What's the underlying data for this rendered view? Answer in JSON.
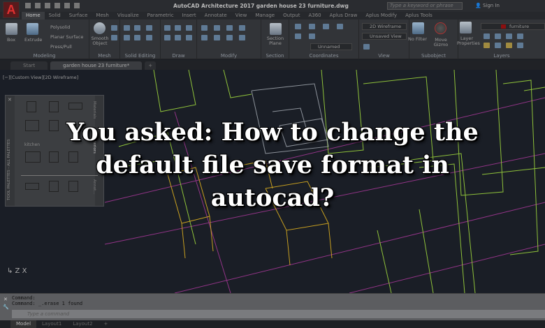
{
  "app": {
    "title": "AutoCAD Architecture 2017   garden house 23 furniture.dwg",
    "logo": "A"
  },
  "search": {
    "placeholder": "Type a keyword or phrase"
  },
  "account": {
    "sign_in": "Sign In"
  },
  "menu_tabs": [
    "Home",
    "Solid",
    "Surface",
    "Mesh",
    "Visualize",
    "Parametric",
    "Insert",
    "Annotate",
    "View",
    "Manage",
    "Output",
    "A360",
    "Aplus Draw",
    "Aplus Modify",
    "Aplus Tools"
  ],
  "ribbon": {
    "modeling": {
      "title": "Modeling",
      "box": "Box",
      "extrude": "Extrude",
      "polysolid": "Polysolid",
      "planar_surface": "Planar Surface",
      "presspull": "Press/Pull"
    },
    "mesh": {
      "title": "Mesh",
      "smooth_object": "Smooth Object"
    },
    "solid_editing": {
      "title": "Solid Editing"
    },
    "draw": {
      "title": "Draw"
    },
    "modify": {
      "title": "Modify"
    },
    "section": {
      "title": "Section",
      "section_plane": "Section Plane"
    },
    "coordinates": {
      "title": "Coordinates",
      "ucs": "Unnamed"
    },
    "view": {
      "title": "View",
      "visual_style": "2D Wireframe",
      "named_view": "Unsaved View"
    },
    "subobject": {
      "title": "Subobject",
      "no_filter": "No Filter",
      "move_gizmo": "Move Gizmo"
    },
    "layers": {
      "title": "Layers",
      "layer_properties": "Layer Properties",
      "current_layer": "furniture",
      "layer_color": "#8b1010"
    }
  },
  "doc_tabs": [
    {
      "label": "Start"
    },
    {
      "label": "garden house 23 furniture*"
    }
  ],
  "viewport": {
    "label": "[−][Custom View][2D Wireframe]"
  },
  "palette": {
    "title": "TOOL PALETTES - ALL PALETTES",
    "category": "kitchen",
    "tabs": [
      "Materials",
      "Interiors",
      "Annot..."
    ]
  },
  "heading": {
    "line1": "You asked: How to change the",
    "line2": "default file save format in",
    "line3": "autocad?"
  },
  "command": {
    "history": [
      "Command:",
      "Command: _.erase 1 found"
    ],
    "placeholder": "Type a command"
  },
  "layout_tabs": [
    "Model",
    "Layout1",
    "Layout2"
  ],
  "colors": {
    "drawing_green": "#8fc23a",
    "drawing_yellow": "#c8a020",
    "drawing_magenta": "#b03aa0",
    "background": "#1a1e26"
  }
}
